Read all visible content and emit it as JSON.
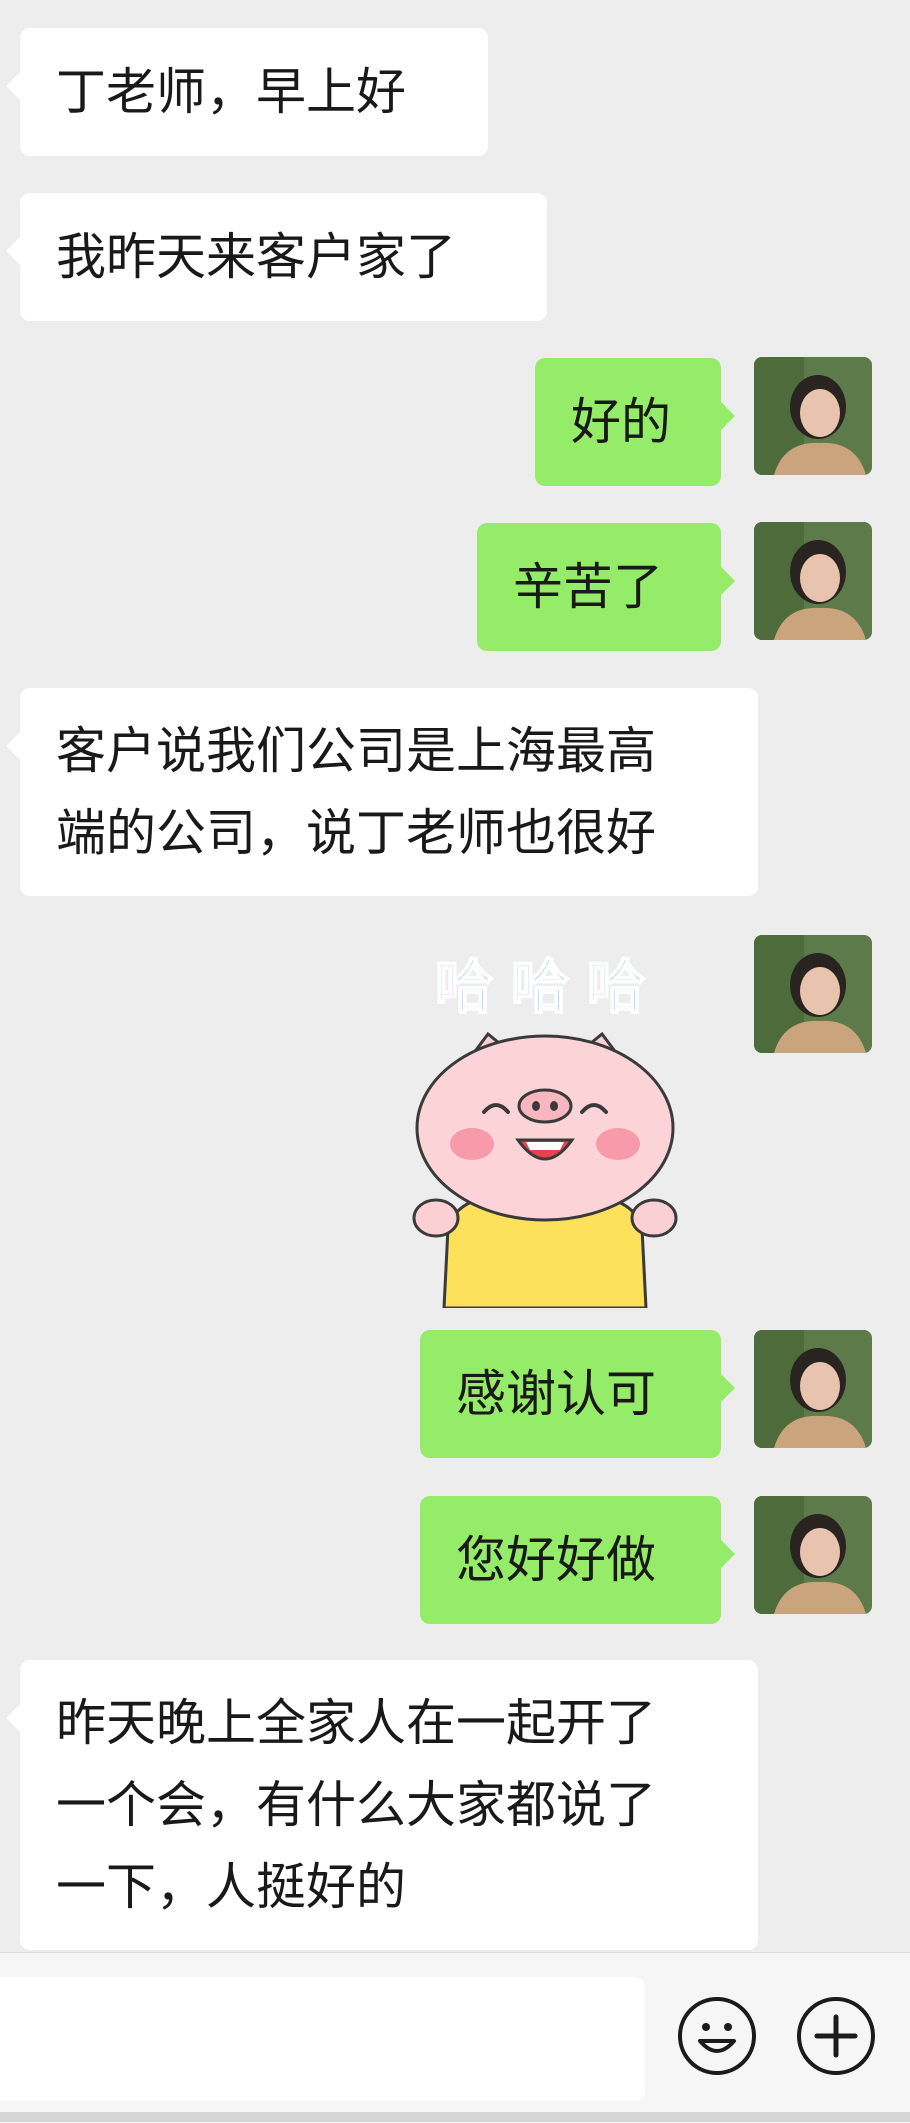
{
  "messages": [
    {
      "direction": "in",
      "lines": [
        "丁老师，早上好"
      ]
    },
    {
      "direction": "in",
      "lines": [
        "我昨天来客户家了"
      ]
    },
    {
      "direction": "out",
      "lines": [
        "好的"
      ]
    },
    {
      "direction": "out",
      "lines": [
        "辛苦了"
      ]
    },
    {
      "direction": "in",
      "lines": [
        "客户说我们公司是上海最高",
        "端的公司，说丁老师也很好"
      ]
    },
    {
      "direction": "out",
      "sticker": {
        "caption": "哈哈哈",
        "icon": "pig-sticker"
      }
    },
    {
      "direction": "out",
      "lines": [
        "感谢认可"
      ]
    },
    {
      "direction": "out",
      "lines": [
        "您好好做"
      ]
    },
    {
      "direction": "in",
      "lines": [
        "昨天晚上全家人在一起开了",
        "一个会，有什么大家都说了",
        "一下，人挺好的"
      ]
    }
  ],
  "composer": {
    "emoji_icon": "emoji-icon",
    "plus_icon": "plus-icon"
  },
  "colors": {
    "background": "#ededed",
    "incoming": "#ffffff",
    "outgoing": "#95ec69",
    "sticker_text": "#6fc6d9"
  }
}
